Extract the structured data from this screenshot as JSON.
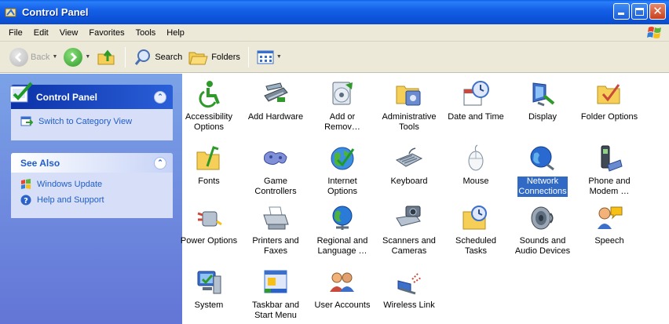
{
  "window": {
    "title": "Control Panel"
  },
  "menu": [
    "File",
    "Edit",
    "View",
    "Favorites",
    "Tools",
    "Help"
  ],
  "toolbar": {
    "back": "Back",
    "search": "Search",
    "folders": "Folders"
  },
  "taskpane": {
    "main_title": "Control Panel",
    "switch_view": "Switch to Category View",
    "see_also_title": "See Also",
    "see_also": [
      "Windows Update",
      "Help and Support"
    ]
  },
  "items": [
    {
      "label": "Accessibility\nOptions",
      "icon": "accessibility-icon"
    },
    {
      "label": "Add Hardware",
      "icon": "add-hardware-icon"
    },
    {
      "label": "Add or\nRemov…",
      "icon": "add-remove-programs-icon"
    },
    {
      "label": "Administrative\nTools",
      "icon": "administrative-tools-icon"
    },
    {
      "label": "Date and Time",
      "icon": "date-time-icon"
    },
    {
      "label": "Display",
      "icon": "display-icon"
    },
    {
      "label": "Folder Options",
      "icon": "folder-options-icon"
    },
    {
      "label": "Fonts",
      "icon": "fonts-icon"
    },
    {
      "label": "Game\nControllers",
      "icon": "game-controllers-icon"
    },
    {
      "label": "Internet\nOptions",
      "icon": "internet-options-icon"
    },
    {
      "label": "Keyboard",
      "icon": "keyboard-icon"
    },
    {
      "label": "Mouse",
      "icon": "mouse-icon"
    },
    {
      "label": "Network\nConnections",
      "icon": "network-connections-icon",
      "selected": true
    },
    {
      "label": "Phone and\nModem …",
      "icon": "phone-modem-icon"
    },
    {
      "label": "Power Options",
      "icon": "power-options-icon"
    },
    {
      "label": "Printers and\nFaxes",
      "icon": "printers-faxes-icon"
    },
    {
      "label": "Regional and\nLanguage …",
      "icon": "regional-language-icon"
    },
    {
      "label": "Scanners and\nCameras",
      "icon": "scanners-cameras-icon"
    },
    {
      "label": "Scheduled\nTasks",
      "icon": "scheduled-tasks-icon"
    },
    {
      "label": "Sounds and\nAudio Devices",
      "icon": "sounds-audio-icon"
    },
    {
      "label": "Speech",
      "icon": "speech-icon"
    },
    {
      "label": "System",
      "icon": "system-icon"
    },
    {
      "label": "Taskbar and\nStart Menu",
      "icon": "taskbar-start-menu-icon"
    },
    {
      "label": "User Accounts",
      "icon": "user-accounts-icon"
    },
    {
      "label": "Wireless Link",
      "icon": "wireless-link-icon"
    }
  ]
}
